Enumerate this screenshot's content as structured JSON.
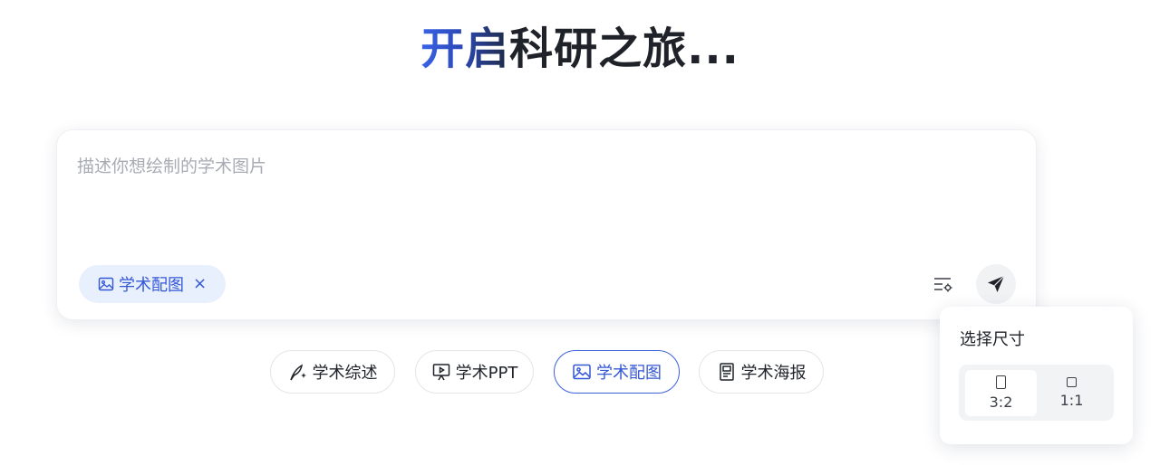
{
  "hero": {
    "title_accent": "开启",
    "title_rest": "科研之旅..."
  },
  "prompt": {
    "placeholder": "描述你想绘制的学术图片",
    "value": "",
    "mode_chip": {
      "label": "学术配图",
      "icon": "image-icon",
      "close_icon": "×"
    },
    "settings_icon": "settings-sliders-icon",
    "send_icon": "send-icon"
  },
  "quick_actions": [
    {
      "label": "学术综述",
      "icon": "quill-sparkle-icon",
      "active": false
    },
    {
      "label": "学术PPT",
      "icon": "presentation-icon",
      "active": false
    },
    {
      "label": "学术配图",
      "icon": "image-icon",
      "active": true
    },
    {
      "label": "学术海报",
      "icon": "poster-icon",
      "active": false
    }
  ],
  "size_popover": {
    "title": "选择尺寸",
    "options": [
      {
        "label": "3:2",
        "selected": true
      },
      {
        "label": "1:1",
        "selected": false
      }
    ]
  },
  "colors": {
    "accent": "#3457d5",
    "chip_bg": "#e9f0fd",
    "text": "#1f2329",
    "placeholder": "#a7abb3"
  }
}
